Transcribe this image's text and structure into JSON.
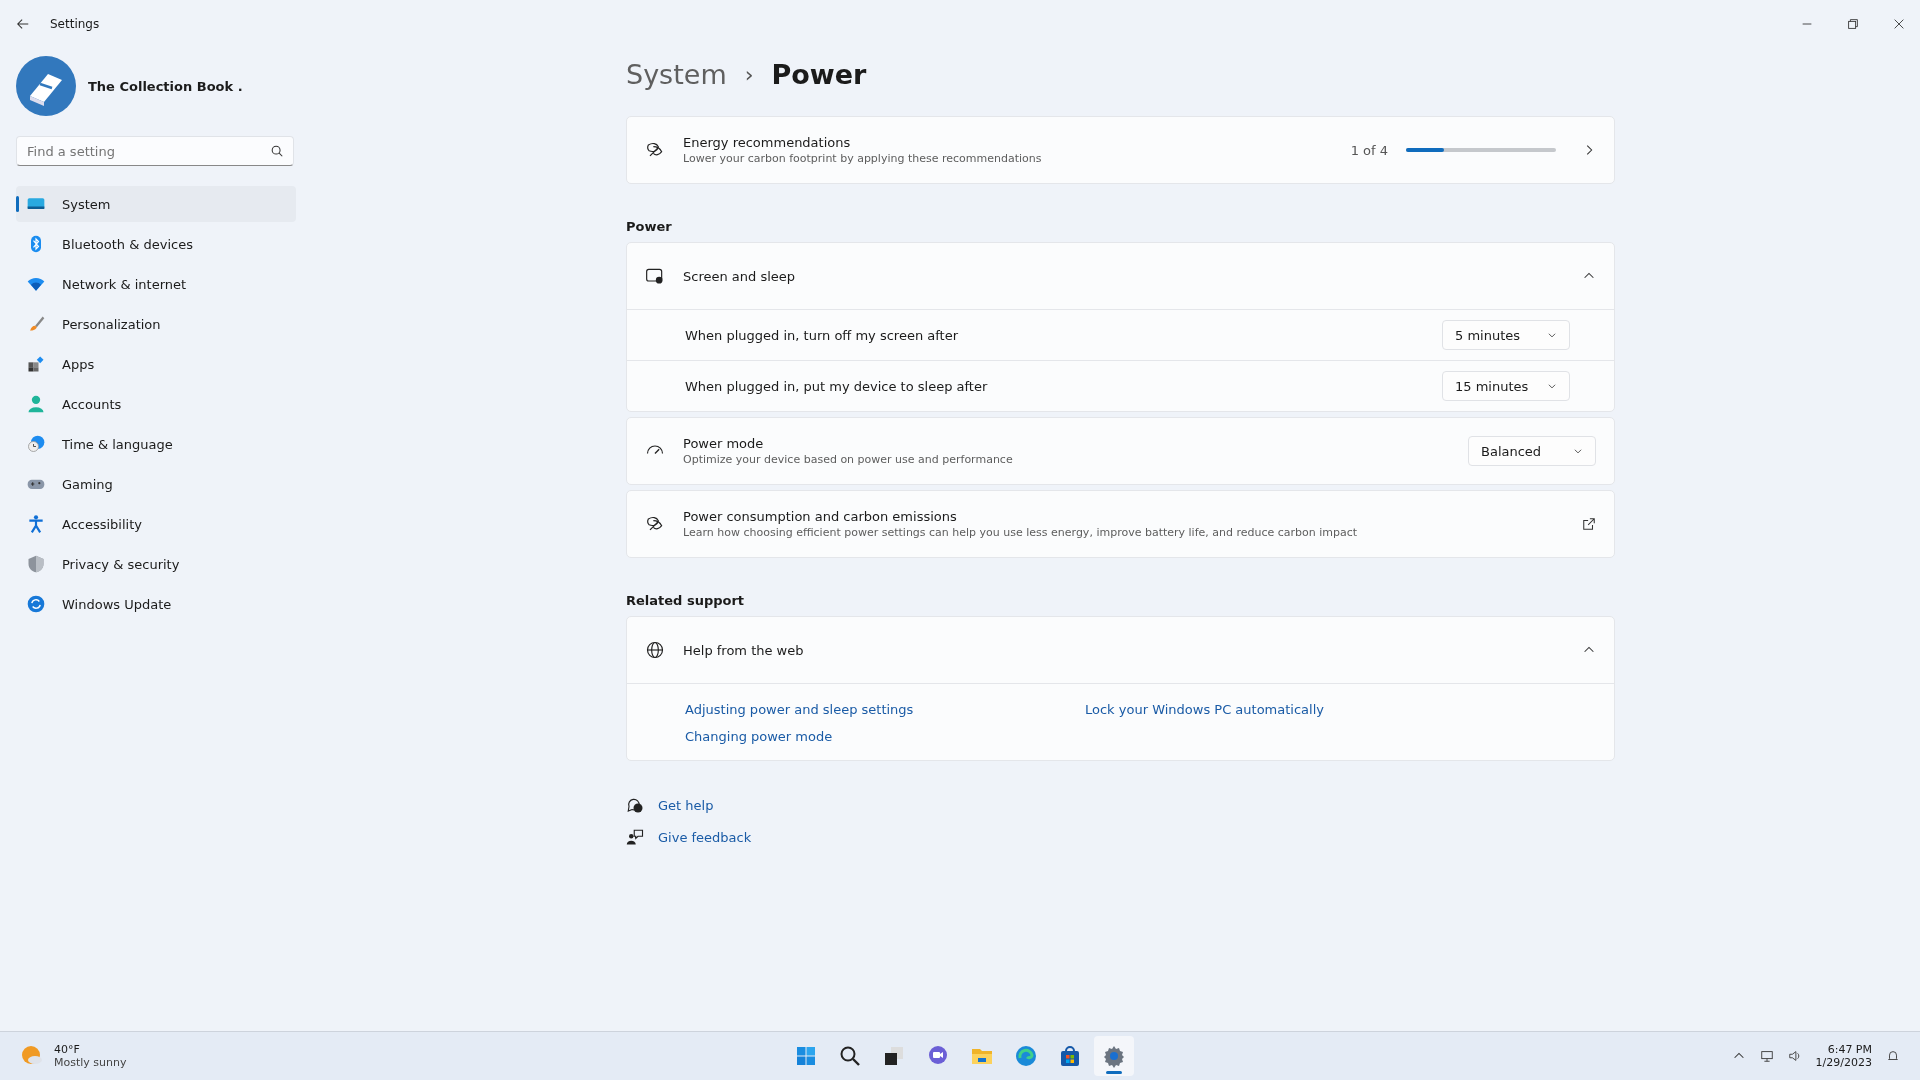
{
  "window": {
    "title": "Settings"
  },
  "profile": {
    "name": "The Collection Book ."
  },
  "search": {
    "placeholder": "Find a setting"
  },
  "sidebar": {
    "items": [
      {
        "label": "System",
        "selected": true
      },
      {
        "label": "Bluetooth & devices",
        "selected": false
      },
      {
        "label": "Network & internet",
        "selected": false
      },
      {
        "label": "Personalization",
        "selected": false
      },
      {
        "label": "Apps",
        "selected": false
      },
      {
        "label": "Accounts",
        "selected": false
      },
      {
        "label": "Time & language",
        "selected": false
      },
      {
        "label": "Gaming",
        "selected": false
      },
      {
        "label": "Accessibility",
        "selected": false
      },
      {
        "label": "Privacy & security",
        "selected": false
      },
      {
        "label": "Windows Update",
        "selected": false
      }
    ]
  },
  "breadcrumb": {
    "parent": "System",
    "separator": "›",
    "current": "Power"
  },
  "energy": {
    "title": "Energy recommendations",
    "description": "Lower your carbon footprint by applying these recommendations",
    "count": "1 of 4",
    "level": 0.25
  },
  "power_heading": "Power",
  "screen_sleep": {
    "title": "Screen and sleep",
    "expanded": true,
    "rows": [
      {
        "label": "When plugged in, turn off my screen after",
        "value": "5 minutes"
      },
      {
        "label": "When plugged in, put my device to sleep after",
        "value": "15 minutes"
      }
    ]
  },
  "power_mode": {
    "title": "Power mode",
    "description": "Optimize your device based on power use and performance",
    "value": "Balanced"
  },
  "consumption": {
    "title": "Power consumption and carbon emissions",
    "description": "Learn how choosing efficient power settings can help you use less energy, improve battery life, and reduce carbon impact"
  },
  "related_heading": "Related support",
  "help_web": {
    "title": "Help from the web",
    "expanded": true,
    "links": [
      "Adjusting power and sleep settings",
      "Lock your Windows PC automatically",
      "Changing power mode"
    ]
  },
  "footer_links": [
    "Get help",
    "Give feedback"
  ],
  "taskbar": {
    "weather": {
      "temperature": "40°F",
      "condition": "Mostly sunny"
    },
    "apps": [
      {
        "active": false
      },
      {
        "active": false
      },
      {
        "active": false
      },
      {
        "active": false
      },
      {
        "active": false
      },
      {
        "active": false
      },
      {
        "active": false
      },
      {
        "active": true
      }
    ],
    "time": "6:47 PM",
    "date": "1/29/2023"
  }
}
